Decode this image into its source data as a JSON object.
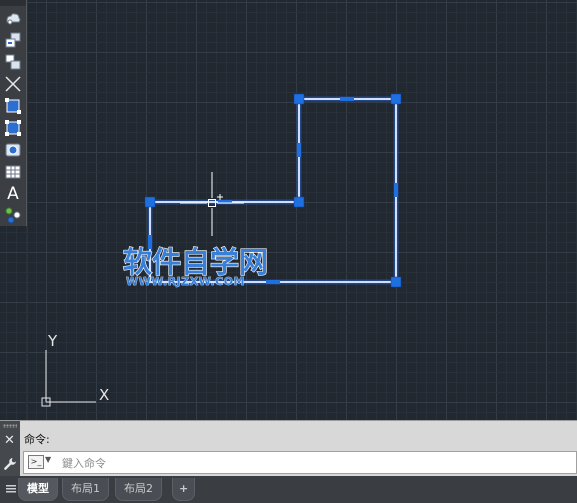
{
  "toolbar": {
    "items": [
      {
        "name": "revision-cloud-icon"
      },
      {
        "name": "insert-block-icon"
      },
      {
        "name": "create-block-icon"
      },
      {
        "name": "xline-icon"
      },
      {
        "name": "hatch-icon"
      },
      {
        "name": "region-icon"
      },
      {
        "name": "boundary-icon"
      },
      {
        "name": "table-icon"
      },
      {
        "name": "text-icon",
        "glyph": "A"
      },
      {
        "name": "add-selected-icon"
      }
    ]
  },
  "watermark": {
    "title": "软件自学网",
    "url": "WWW.RJZXW.COM"
  },
  "ucs": {
    "y_label": "Y",
    "x_label": "X"
  },
  "command": {
    "history_label": "命令:",
    "input_placeholder": "鍵入命令",
    "close_glyph": "✕"
  },
  "tabs": {
    "items": [
      {
        "label": "模型",
        "active": true
      },
      {
        "label": "布局1",
        "active": false
      },
      {
        "label": "布局2",
        "active": false
      },
      {
        "label": "+",
        "active": false
      }
    ]
  },
  "colors": {
    "background": "#212830",
    "grid_minor": "#283039",
    "grid_major": "#333d48",
    "polyline": "#c8d8ff",
    "grip": "#1e6fe0",
    "watermark_fill": "#3a7fd6"
  }
}
